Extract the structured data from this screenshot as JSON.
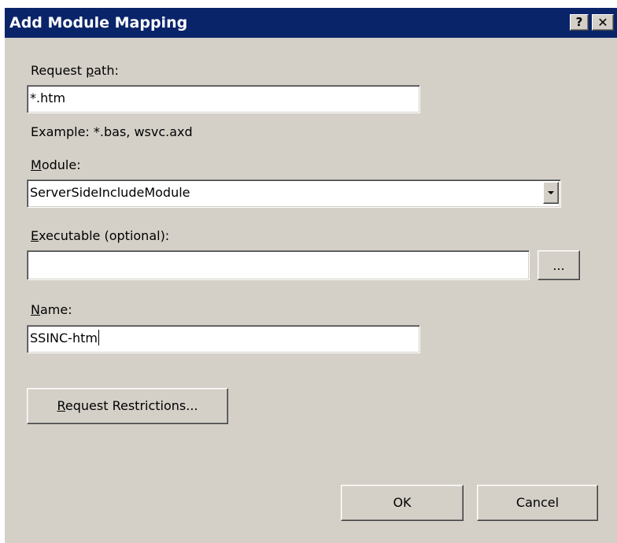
{
  "window": {
    "title": "Add Module Mapping",
    "help_label": "?",
    "close_label": "✕"
  },
  "request_path": {
    "label_pre": "Request ",
    "label_access": "p",
    "label_post": "ath:",
    "value": "*.htm",
    "example": "Example: *.bas, wsvc.axd"
  },
  "module": {
    "label_access": "M",
    "label_post": "odule:",
    "value": "ServerSideIncludeModule"
  },
  "executable": {
    "label_access": "E",
    "label_post": "xecutable (optional):",
    "value": "",
    "browse_label": "..."
  },
  "name": {
    "label_access": "N",
    "label_post": "ame:",
    "value": "SSINC-htm"
  },
  "buttons": {
    "restrictions_access": "R",
    "restrictions_post": "equest Restrictions...",
    "ok": "OK",
    "cancel": "Cancel"
  },
  "colors": {
    "titlebar": "#0a246a",
    "dialog_face": "#d4d0c8",
    "field_bg": "#ffffff"
  }
}
